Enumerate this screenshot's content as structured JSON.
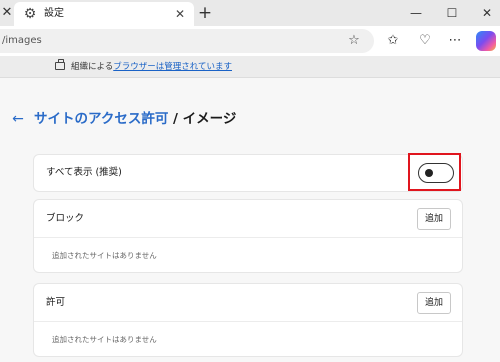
{
  "browser": {
    "tab_close_left": "✕",
    "tab": {
      "title": "設定",
      "icon": "gear-icon",
      "close": "✕"
    },
    "new_tab": "+",
    "window_controls": {
      "minimize": "—",
      "maximize": "☐",
      "close": "✕"
    },
    "address": "/images",
    "toolbar_icons": [
      "star-icon",
      "favorites-icon",
      "browser-essentials-icon",
      "more-icon",
      "copilot-icon"
    ]
  },
  "managed_banner": {
    "prefix": "組織による",
    "link": "ブラウザーは管理されています"
  },
  "header": {
    "back": "←",
    "parent": "サイトのアクセス許可",
    "separator": " / ",
    "current": "イメージ"
  },
  "allow_all": {
    "label": "すべて表示 (推奨)",
    "toggle_on": false
  },
  "block": {
    "title": "ブロック",
    "add_label": "追加",
    "empty": "追加されたサイトはありません"
  },
  "allow": {
    "title": "許可",
    "add_label": "追加",
    "empty": "追加されたサイトはありません"
  }
}
